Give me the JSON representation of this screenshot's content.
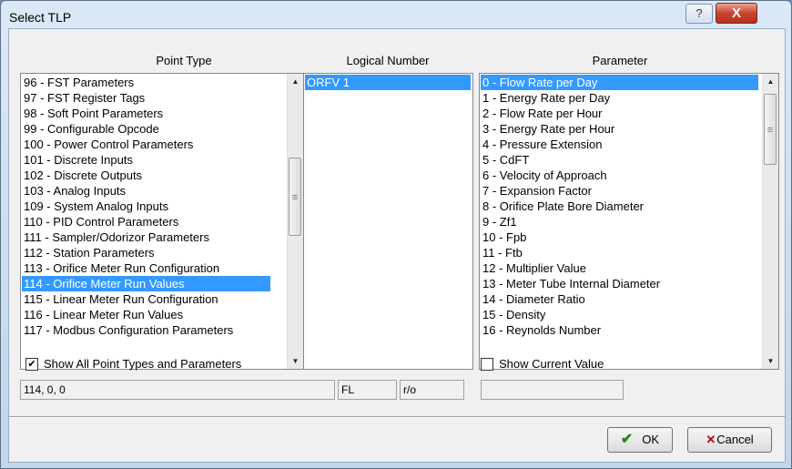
{
  "window": {
    "title": "Select TLP",
    "help_icon": "?",
    "close_icon": "X"
  },
  "headers": {
    "point_type": "Point Type",
    "logical_number": "Logical Number",
    "parameter": "Parameter"
  },
  "point_types": [
    "96 - FST Parameters",
    "97 - FST Register Tags",
    "98 - Soft Point Parameters",
    "99 - Configurable Opcode",
    "100 - Power Control Parameters",
    "101 - Discrete Inputs",
    "102 - Discrete Outputs",
    "103 - Analog Inputs",
    "109 - System Analog Inputs",
    "110 - PID Control Parameters",
    "111 - Sampler/Odorizor Parameters",
    "112 - Station Parameters",
    "113 - Orifice Meter Run Configuration",
    "114 - Orifice Meter Run Values",
    "115 - Linear Meter Run Configuration",
    "116 - Linear Meter Run Values",
    "117 - Modbus Configuration Parameters"
  ],
  "point_type_selected": "114 - Orifice Meter Run Values",
  "logical_numbers": [
    "ORFV 1"
  ],
  "parameters": [
    "0 - Flow Rate per Day",
    "1 - Energy Rate per Day",
    "2 - Flow Rate per Hour",
    "3 - Energy Rate per Hour",
    "4 - Pressure Extension",
    "5 - CdFT",
    "6 - Velocity of Approach",
    "7 - Expansion Factor",
    "8 - Orifice Plate Bore Diameter",
    "9 - Zf1",
    "10 - Fpb",
    "11 - Ftb",
    "12 - Multiplier Value",
    "13 - Meter Tube Internal Diameter",
    "14 - Diameter Ratio",
    "15 - Density",
    "16 - Reynolds Number"
  ],
  "parameter_selected": "0 - Flow Rate per Day",
  "show_all": {
    "label": "Show All Point Types and Parameters",
    "checked": true,
    "check_glyph": "✔"
  },
  "show_current": {
    "label": "Show Current Value",
    "checked": false
  },
  "tlp_field": "114, 0, 0",
  "type_field": "FL",
  "access_field": "r/o",
  "current_value_field": "",
  "buttons": {
    "ok_label": "OK",
    "ok_icon": "✔",
    "cancel_label": "Cancel",
    "cancel_icon": "✕"
  },
  "scroll_glyphs": {
    "up": "▲",
    "down": "▼",
    "grip": "≡"
  }
}
